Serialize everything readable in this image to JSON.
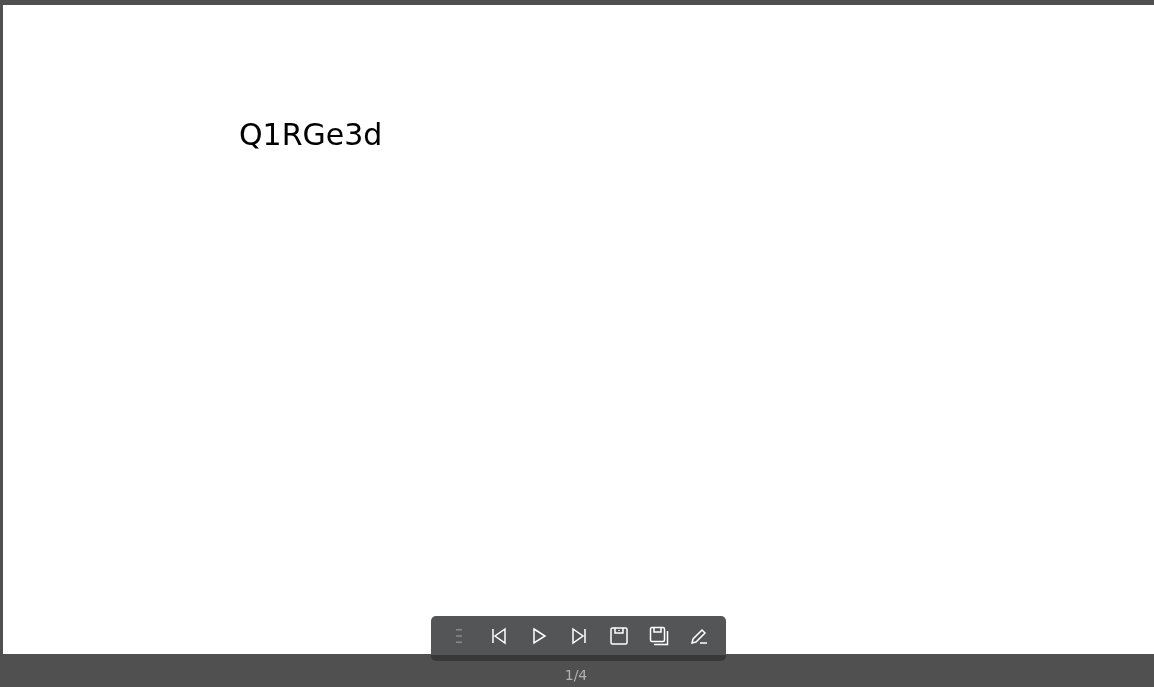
{
  "slide": {
    "text": "Q1RGe3d"
  },
  "toolbar": [
    {
      "kind": "menu",
      "disabled": true
    },
    {
      "kind": "first",
      "disabled": false
    },
    {
      "kind": "play",
      "disabled": false
    },
    {
      "kind": "last",
      "disabled": false
    },
    {
      "kind": "save",
      "disabled": false
    },
    {
      "kind": "save-all",
      "disabled": false
    },
    {
      "kind": "edit",
      "disabled": false
    }
  ],
  "status_bar": {
    "page": "1/4"
  }
}
